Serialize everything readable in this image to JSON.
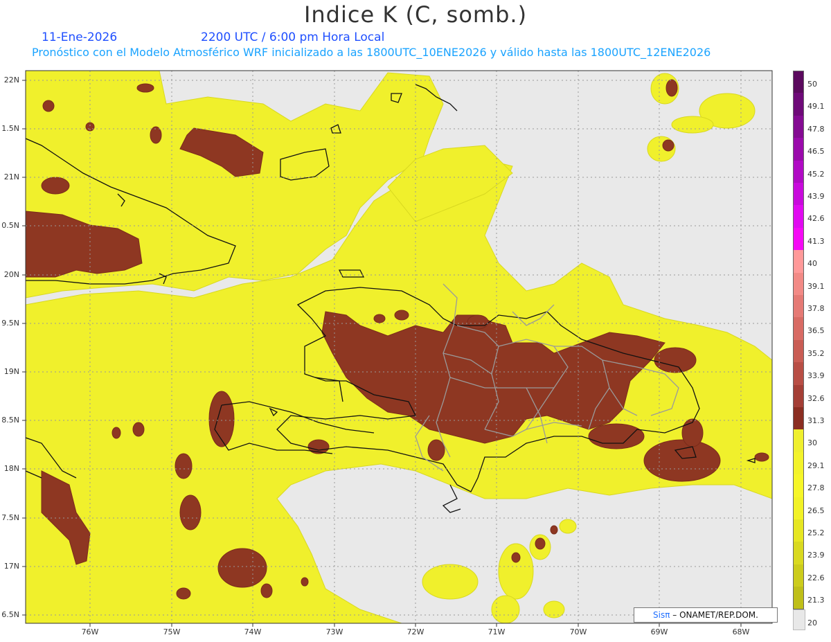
{
  "header": {
    "title": "Indice K (C, somb.)",
    "date": "11-Ene-2026",
    "time": "2200 UTC / 6:00 pm Hora Local",
    "subtitle": "Pronóstico con el Modelo Atmosférico WRF inicializado a las 1800UTC_10ENE2026 y válido hasta las  1800UTC_12ENE2026"
  },
  "map": {
    "lat_labels": [
      "22N",
      "1.5N",
      "21N",
      "0.5N",
      "20N",
      "9.5N",
      "19N",
      "8.5N",
      "18N",
      "7.5N",
      "17N",
      "6.5N"
    ],
    "lon_labels": [
      "76W",
      "75W",
      "74W",
      "73W",
      "72W",
      "71W",
      "70W",
      "69W",
      "68W"
    ],
    "background_color": "#e9e9e9"
  },
  "colorbar": {
    "labels": [
      "50",
      "49.1",
      "47.8",
      "46.5",
      "45.2",
      "43.9",
      "42.6",
      "41.3",
      "40",
      "39.1",
      "37.8",
      "36.5",
      "35.2",
      "33.9",
      "32.6",
      "31.3",
      "30",
      "29.1",
      "27.8",
      "26.5",
      "25.2",
      "23.9",
      "22.6",
      "21.3",
      "20"
    ],
    "colors": [
      "#5b0a5e",
      "#6e0a78",
      "#840b92",
      "#9a0aab",
      "#b00ac4",
      "#c80adc",
      "#e00af0",
      "#f50af5",
      "#ff9999",
      "#f28a86",
      "#e57a75",
      "#d86b64",
      "#c95d54",
      "#b84e45",
      "#a43f36",
      "#8b2e22",
      "#efef2e",
      "#f3f32a",
      "#f6f628",
      "#f2f226",
      "#e6e622",
      "#d9d920",
      "#cccc1c",
      "#bfbf19"
    ],
    "bottom_color": "#e8e8e8"
  },
  "credit": {
    "sis": "Sisπ",
    "org": " – ONAMET/REP.DOM."
  }
}
